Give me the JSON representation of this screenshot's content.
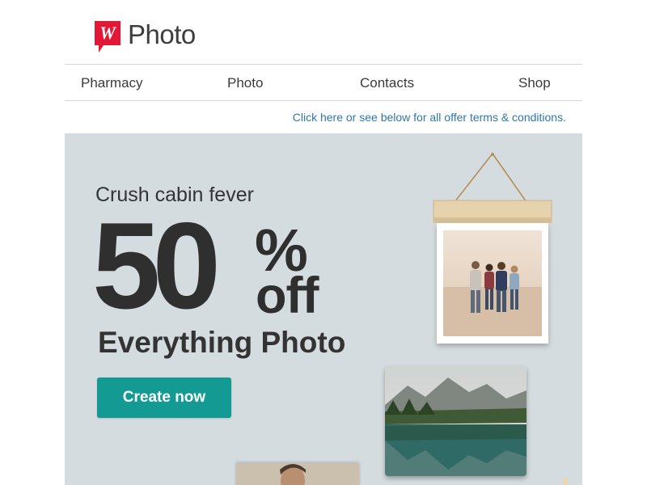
{
  "brand": {
    "name": "Photo",
    "mark_letter": "W",
    "mark_color": "#e31837"
  },
  "nav": {
    "items": [
      {
        "label": "Pharmacy"
      },
      {
        "label": "Photo"
      },
      {
        "label": "Contacts"
      },
      {
        "label": "Shop"
      }
    ]
  },
  "offer_terms_link": "Click here or see below for all offer terms & conditions.",
  "hero": {
    "tagline": "Crush cabin fever",
    "discount_number": "50",
    "discount_symbol": "%",
    "discount_word": "off",
    "subhead": "Everything Photo",
    "cta_label": "Create now",
    "colors": {
      "background": "#d5dcdf",
      "text": "#2f2f2f",
      "cta": "#139b93"
    }
  },
  "icons": {
    "brand_logo": "walgreens-w-logo-icon"
  }
}
